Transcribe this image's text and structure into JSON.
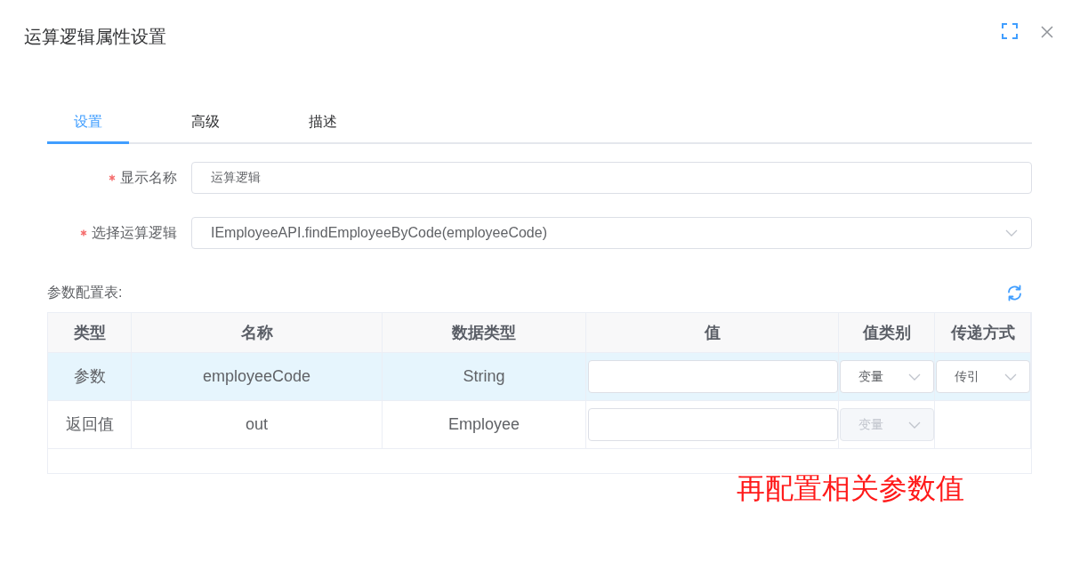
{
  "dialog": {
    "title": "运算逻辑属性设置"
  },
  "tabs": [
    {
      "label": "设置",
      "selected": true
    },
    {
      "label": "高级",
      "selected": false
    },
    {
      "label": "描述",
      "selected": false
    }
  ],
  "form_fields": [
    {
      "kind": "input",
      "label": "显示名称",
      "required": true,
      "value": "运算逻辑"
    },
    {
      "kind": "select",
      "label": "选择运算逻辑",
      "required": true,
      "value": "IEmployeeAPI.findEmployeeByCode(employeeCode)"
    }
  ],
  "param_table": {
    "title": "参数配置表:",
    "columns": [
      "类型",
      "名称",
      "数据类型",
      "值",
      "值类别",
      "传递方式"
    ],
    "rows": [
      {
        "selected": true,
        "type": "参数",
        "name": "employeeCode",
        "data_type": "String",
        "value_type": {
          "value": "变量",
          "disabled": false
        },
        "pass_mode": {
          "value": "传引",
          "disabled": false
        }
      },
      {
        "selected": false,
        "type": "返回值",
        "name": "out",
        "data_type": "Employee",
        "value_type": {
          "value": "变量",
          "disabled": true
        }
      }
    ]
  },
  "annotation": "再配置相关参数值"
}
